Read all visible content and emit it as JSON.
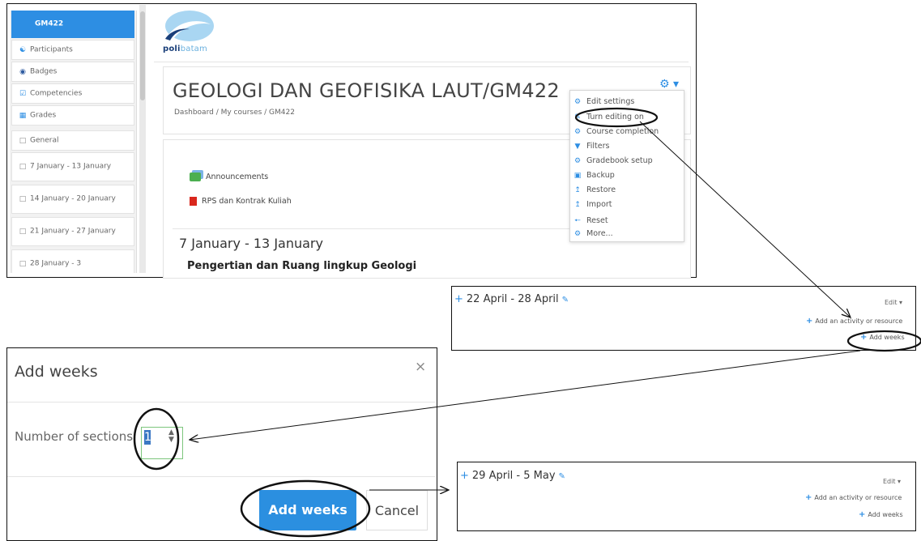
{
  "sidebar": {
    "items": [
      {
        "label": "GM422",
        "icon": "none"
      },
      {
        "label": "Participants",
        "icon": "users-icon"
      },
      {
        "label": "Badges",
        "icon": "badge-icon"
      },
      {
        "label": "Competencies",
        "icon": "checkbox-icon"
      },
      {
        "label": "Grades",
        "icon": "table-icon"
      },
      {
        "label": "General",
        "icon": "folder-icon"
      },
      {
        "label": "7 January - 13 January",
        "icon": "folder-icon"
      },
      {
        "label": "14 January - 20 January",
        "icon": "folder-icon"
      },
      {
        "label": "21 January - 27 January",
        "icon": "folder-icon"
      },
      {
        "label": "28 January - 3",
        "icon": "folder-icon"
      }
    ]
  },
  "logo": {
    "poli": "poli",
    "batam": "batam"
  },
  "course": {
    "title": "GEOLOGI DAN GEOFISIKA LAUT/GM422",
    "breadcrumb": "Dashboard  /  My courses  /  GM422",
    "activities": [
      "Announcements",
      "RPS dan Kontrak Kuliah"
    ],
    "section_heading": "7 January - 13 January",
    "section_subtitle": "Pengertian dan Ruang lingkup Geologi"
  },
  "settings_menu": {
    "gear": "⚙ ▾",
    "items": [
      {
        "label": "Edit settings",
        "icon": "gear-icon"
      },
      {
        "label": "Turn editing on",
        "icon": "pencil-icon"
      },
      {
        "label": "Course completion",
        "icon": "gear-icon"
      },
      {
        "label": "Filters",
        "icon": "filter-icon"
      },
      {
        "label": "Gradebook setup",
        "icon": "gear-icon"
      },
      {
        "label": "Backup",
        "icon": "backup-icon"
      },
      {
        "label": "Restore",
        "icon": "restore-icon"
      },
      {
        "label": "Import",
        "icon": "import-icon"
      },
      {
        "label": "Reset",
        "icon": "reset-icon"
      },
      {
        "label": "More...",
        "icon": "gear-icon"
      }
    ]
  },
  "section_before": {
    "title": "22 April - 28 April",
    "edit": "Edit ▾",
    "add_activity": "Add an activity or resource",
    "add_weeks": "Add weeks"
  },
  "modal": {
    "title": "Add weeks",
    "close": "×",
    "field_label": "Number of sections",
    "field_value": "1",
    "submit": "Add weeks",
    "cancel": "Cancel"
  },
  "section_after": {
    "title": "29 April - 5 May",
    "edit": "Edit ▾",
    "add_activity": "Add an activity or resource",
    "add_weeks": "Add weeks"
  },
  "colors": {
    "accent": "#2d8ee3",
    "active_sidebar": "#2d8ee3",
    "button": "#2b8fe0"
  }
}
